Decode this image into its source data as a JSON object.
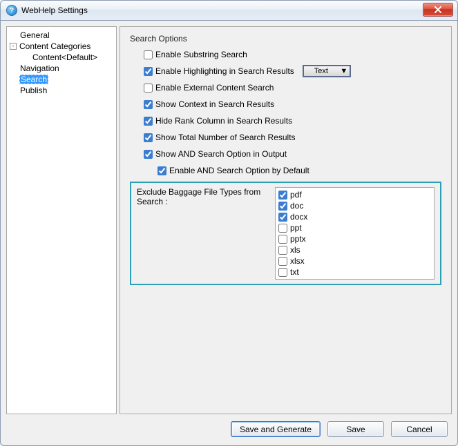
{
  "title": "WebHelp Settings",
  "tree": {
    "items": [
      {
        "label": "General",
        "level": 0,
        "selected": false
      },
      {
        "label": "Content Categories",
        "level": 0,
        "selected": false,
        "expander": "-"
      },
      {
        "label": "Content<Default>",
        "level": 1,
        "selected": false
      },
      {
        "label": "Navigation",
        "level": 0,
        "selected": false
      },
      {
        "label": "Search",
        "level": 0,
        "selected": true
      },
      {
        "label": "Publish",
        "level": 0,
        "selected": false
      }
    ]
  },
  "search_options": {
    "group_label": "Search Options",
    "enable_substring": {
      "label": "Enable Substring Search",
      "checked": false
    },
    "enable_highlight": {
      "label": "Enable Highlighting in Search Results",
      "checked": true
    },
    "highlight_combo": "Text",
    "enable_external": {
      "label": "Enable External Content Search",
      "checked": false
    },
    "show_context": {
      "label": "Show Context in Search Results",
      "checked": true
    },
    "hide_rank": {
      "label": "Hide Rank Column in Search Results",
      "checked": true
    },
    "show_total": {
      "label": "Show Total Number of Search Results",
      "checked": true
    },
    "show_and": {
      "label": "Show AND Search Option in Output",
      "checked": true
    },
    "enable_and_default": {
      "label": "Enable AND Search Option by Default",
      "checked": true
    },
    "exclude_label": "Exclude Baggage File Types from Search :",
    "file_types": [
      {
        "label": "pdf",
        "checked": true
      },
      {
        "label": "doc",
        "checked": true
      },
      {
        "label": "docx",
        "checked": true
      },
      {
        "label": "ppt",
        "checked": false
      },
      {
        "label": "pptx",
        "checked": false
      },
      {
        "label": "xls",
        "checked": false
      },
      {
        "label": "xlsx",
        "checked": false
      },
      {
        "label": "txt",
        "checked": false
      }
    ]
  },
  "buttons": {
    "save_and_generate": "Save and Generate",
    "save": "Save",
    "cancel": "Cancel"
  }
}
